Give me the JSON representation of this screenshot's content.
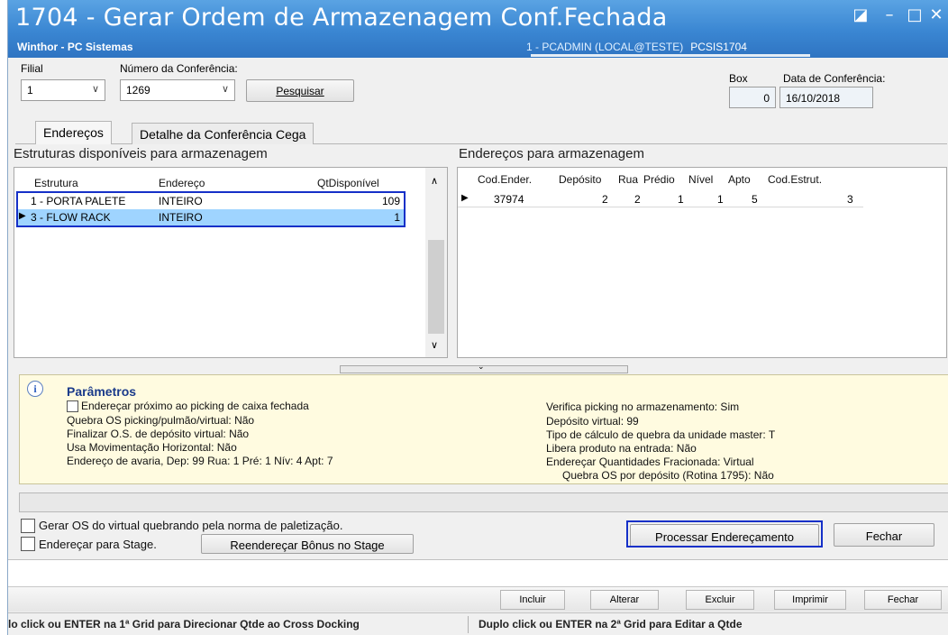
{
  "window": {
    "title": "1704 - Gerar Ordem de Armazenagem Conf.Fechada",
    "subtitle": "Winthor - PC Sistemas",
    "user": "1 - PCADMIN (LOCAL@TESTE)",
    "routine": "PCSIS1704",
    "controls": {
      "restore": "◪",
      "minimize": "–",
      "maximize": "□",
      "close": "✕"
    }
  },
  "form": {
    "filial_label": "Filial",
    "filial_value": "1",
    "conferencia_label": "Número da Conferência:",
    "conferencia_value": "1269",
    "pesquisar_label": "Pesquisar",
    "box_label": "Box",
    "box_value": "0",
    "data_label": "Data de Conferência:",
    "data_value": "16/10/2018"
  },
  "tabs": [
    "Endereços",
    "Detalhe da Conferência Cega"
  ],
  "left_grid": {
    "title": "Estruturas disponíveis para armazenagem",
    "columns": [
      "Estrutura",
      "Endereço",
      "QtDisponível"
    ],
    "rows": [
      {
        "estrutura": "1 - PORTA PALETE",
        "endereco": "INTEIRO",
        "qt": "109"
      },
      {
        "estrutura": "3 - FLOW RACK",
        "endereco": "INTEIRO",
        "qt": "1"
      }
    ]
  },
  "right_grid": {
    "title": "Endereços para armazenagem",
    "columns": [
      "Cod.Ender.",
      "Depósito",
      "Rua",
      "Prédio",
      "Nível",
      "Apto",
      "Cod.Estrut."
    ],
    "rows": [
      {
        "cod": "37974",
        "deposito": "2",
        "rua": "2",
        "predio": "1",
        "nivel": "1",
        "apto": "5",
        "estrut": "3"
      }
    ]
  },
  "params": {
    "title": "Parâmetros",
    "checkbox_label": "Endereçar próximo ao picking de caixa fechada",
    "left": [
      "Quebra OS picking/pulmão/virtual: Não",
      "Finalizar O.S. de depósito virtual: Não",
      "Usa Movimentação Horizontal: Não",
      "Endereço de avaria, Dep: 99 Rua: 1 Pré: 1 Nív: 4 Apt: 7"
    ],
    "right": [
      "Verifica picking no armazenamento: Sim",
      "Depósito virtual: 99",
      "Tipo de cálculo de quebra da unidade master: T",
      "Libera produto na entrada: Não",
      "Endereçar Quantidades Fracionada: Virtual",
      "Quebra OS por depósito (Rotina 1795): Não"
    ]
  },
  "options": {
    "gerar_os_label": "Gerar OS do virtual quebrando pela norma de paletização.",
    "stage_label": "Endereçar para Stage.",
    "reenderecar_label": "Reendereçar Bônus no Stage",
    "processar_label": "Processar Endereçamento",
    "fechar_label": "Fechar"
  },
  "toolbar": [
    "Incluir",
    "Alterar",
    "Excluir",
    "Imprimir",
    "Fechar"
  ],
  "status": {
    "left": "lo click ou ENTER na 1ª Grid para Direcionar Qtde ao Cross Docking",
    "right": "Duplo click ou ENTER na 2ª Grid para Editar a Qtde"
  }
}
